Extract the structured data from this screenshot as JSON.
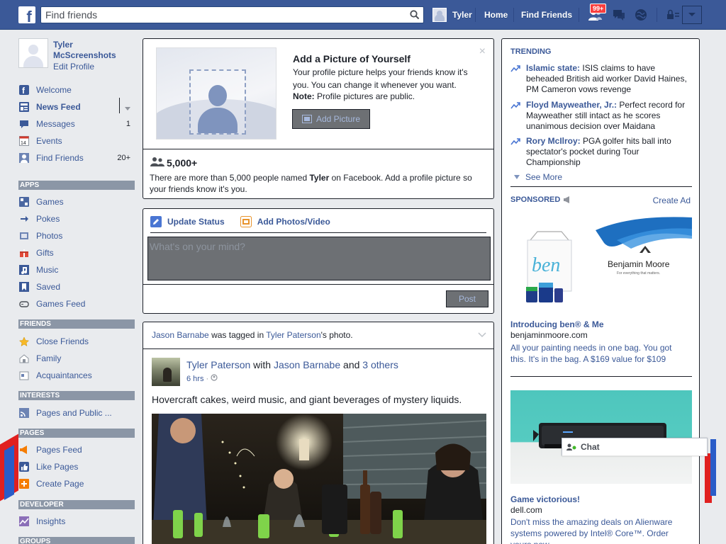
{
  "topbar": {
    "logo_letter": "f",
    "search_placeholder": "Find friends",
    "user_name": "Tyler",
    "home_label": "Home",
    "find_friends_label": "Find Friends",
    "friend_requests_badge": "99+",
    "brand_color": "#3b5998"
  },
  "sidebar": {
    "profile_name": "Tyler McScreenshots",
    "edit_profile": "Edit Profile",
    "favorites": [
      {
        "label": "Welcome",
        "icon": "welcome-icon",
        "count": ""
      },
      {
        "label": "News Feed",
        "icon": "news-feed-icon",
        "count": ""
      },
      {
        "label": "Messages",
        "icon": "messages-icon",
        "count": "1"
      },
      {
        "label": "Events",
        "icon": "events-icon",
        "count": "",
        "date_glyph": "14"
      },
      {
        "label": "Find Friends",
        "icon": "find-friends-icon",
        "count": "20+"
      }
    ],
    "apps_header": "APPS",
    "apps": [
      {
        "label": "Games",
        "icon": "games-icon"
      },
      {
        "label": "Pokes",
        "icon": "pokes-icon"
      },
      {
        "label": "Photos",
        "icon": "photos-icon"
      },
      {
        "label": "Gifts",
        "icon": "gifts-icon"
      },
      {
        "label": "Music",
        "icon": "music-icon"
      },
      {
        "label": "Saved",
        "icon": "saved-icon"
      },
      {
        "label": "Games Feed",
        "icon": "games-feed-icon"
      }
    ],
    "friends_header": "FRIENDS",
    "friends": [
      {
        "label": "Close Friends",
        "icon": "star-icon"
      },
      {
        "label": "Family",
        "icon": "family-icon"
      },
      {
        "label": "Acquaintances",
        "icon": "acquaintances-icon"
      }
    ],
    "interests_header": "INTERESTS",
    "interests": [
      {
        "label": "Pages and Public ...",
        "icon": "rss-icon"
      }
    ],
    "pages_header": "PAGES",
    "pages": [
      {
        "label": "Pages Feed",
        "icon": "megaphone-icon"
      },
      {
        "label": "Like Pages",
        "icon": "thumbs-up-icon"
      },
      {
        "label": "Create Page",
        "icon": "plus-icon"
      }
    ],
    "developer_header": "DEVELOPER",
    "developer": [
      {
        "label": "Insights",
        "icon": "chart-icon"
      }
    ],
    "groups_header": "GROUPS"
  },
  "add_picture": {
    "title": "Add a Picture of Yourself",
    "description": "Your profile picture helps your friends know it's you. You can change it whenever you want.",
    "note_label": "Note:",
    "note_text": " Profile pictures are public.",
    "button": "Add Picture",
    "close": "×",
    "people_count": "5,000+",
    "people_text_before": "There are more than 5,000 people named ",
    "people_name": "Tyler",
    "people_text_after": " on Facebook. Add a profile picture so your friends know it's you."
  },
  "composer": {
    "tab_status": "Update Status",
    "tab_photos": "Add Photos/Video",
    "placeholder": "What's on your mind?",
    "post_button": "Post"
  },
  "story": {
    "context_actor": "Jason Barnabe",
    "context_mid": " was tagged in ",
    "context_target": "Tyler Paterson",
    "context_end": "'s photo.",
    "author": "Tyler Paterson",
    "with_word": " with ",
    "with_name": "Jason Barnabe",
    "and_word": " and ",
    "others": "3 others",
    "time": "6 hrs",
    "text": "Hovercraft cakes, weird music, and giant beverages of mystery liquids."
  },
  "trending": {
    "header": "TRENDING",
    "items": [
      {
        "topic": "Islamic state:",
        "text": " ISIS claims to have beheaded British aid worker David Haines, PM Cameron vows revenge"
      },
      {
        "topic": "Floyd Mayweather, Jr.:",
        "text": " Perfect record for Mayweather still intact as he scores unanimous decision over Maidana"
      },
      {
        "topic": "Rory McIlroy:",
        "text": " PGA golfer hits ball into spectator's pocket during Tour Championship"
      }
    ],
    "see_more": "See More"
  },
  "sponsored": {
    "header": "SPONSORED",
    "create_ad": "Create Ad",
    "ads": [
      {
        "image_bag_text": "ben",
        "image_brand": "Benjamin Moore",
        "image_tagline": "For everything that matters.",
        "title": "Introducing ben® & Me",
        "domain": "benjaminmoore.com",
        "body": "All your painting needs in one bag. You got this. It's in the bag. A $169 value for $109"
      },
      {
        "title": "Game victorious!",
        "domain": "dell.com",
        "body": "Don't miss the amazing deals on Alienware systems powered by Intel® Core™. Order yours now"
      }
    ]
  },
  "chat": {
    "label": "Chat"
  }
}
